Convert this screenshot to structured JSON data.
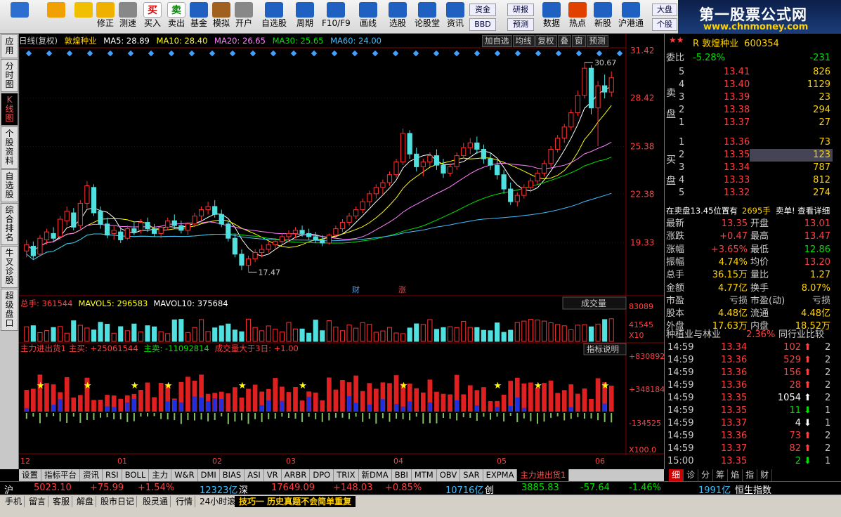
{
  "toolbar": {
    "items": [
      {
        "label": "",
        "icon": "windows-grid-icon"
      },
      {
        "label": "",
        "icon": "back-arrow-icon"
      },
      {
        "label": "",
        "icon": "updown-arrow-icon"
      },
      {
        "label": "修正",
        "icon": "smiley-icon"
      },
      {
        "label": "测速",
        "icon": "clock-icon"
      },
      {
        "label": "买入",
        "icon": "buy-icon",
        "glyph": "买"
      },
      {
        "label": "卖出",
        "icon": "sell-icon",
        "glyph": "卖"
      },
      {
        "label": "基金",
        "icon": "fund-icon"
      },
      {
        "label": "模拟",
        "icon": "hammer-icon"
      },
      {
        "label": "开户",
        "icon": "lock-icon"
      },
      {
        "label": "自选股",
        "icon": "star-folder-icon"
      },
      {
        "label": "周期",
        "icon": "clock-cycle-icon"
      },
      {
        "label": "F10/F9",
        "icon": "f10-icon"
      },
      {
        "label": "画线",
        "icon": "pen-icon"
      },
      {
        "label": "选股",
        "icon": "select-stock-icon"
      },
      {
        "label": "论股堂",
        "icon": "discuss-icon"
      },
      {
        "label": "资讯",
        "icon": "news-icon"
      },
      {
        "label": "数据",
        "icon": "pe-icon"
      },
      {
        "label": "热点",
        "icon": "hot-icon"
      },
      {
        "label": "新股",
        "icon": "new-stock-icon"
      },
      {
        "label": "沪港通",
        "icon": "hk-icon"
      }
    ],
    "small": {
      "zijin": "资金",
      "bbd": "BBD",
      "yanbao": "研报",
      "yuce": "预测",
      "dapan": "大盘",
      "gegu": "个股"
    }
  },
  "brand": {
    "title": "第一股票公式网",
    "url": "www.chnmoney.com"
  },
  "left_tabs": [
    "应用",
    "分时图",
    "K线图",
    "个股资料",
    "自选股",
    "综合排名",
    "牛叉诊股",
    "超级盘口"
  ],
  "chart_header": {
    "period": "日线(复权)",
    "stock": "敦煌种业",
    "ma5": "MA5: 28.89",
    "ma10": "MA10: 28.40",
    "ma20": "MA20: 26.65",
    "ma30": "MA30: 25.65",
    "ma60": "MA60: 24.00",
    "buttons": [
      "加自选",
      "均线",
      "复权",
      "叠",
      "窗",
      "预测"
    ]
  },
  "price_axis": [
    "31.42",
    "28.42",
    "25.38",
    "22.38",
    "19.33"
  ],
  "chart_data": [
    {
      "type": "candlestick",
      "months": [
        "12",
        "01",
        "02",
        "03",
        "04",
        "05",
        "06"
      ],
      "high_label": "30.67",
      "low_label": "17.47",
      "markers": [
        "财",
        "涨"
      ],
      "ohlc": [
        [
          18.8,
          19.5,
          18.4,
          19.2
        ],
        [
          19.1,
          19.4,
          18.3,
          18.5
        ],
        [
          18.6,
          19.8,
          18.5,
          19.6
        ],
        [
          19.5,
          20.2,
          19.2,
          20.0
        ],
        [
          19.9,
          20.3,
          19.4,
          19.6
        ],
        [
          19.7,
          21.0,
          19.5,
          20.8
        ],
        [
          20.7,
          21.6,
          20.4,
          21.3
        ],
        [
          21.2,
          21.5,
          20.1,
          20.3
        ],
        [
          20.4,
          22.0,
          20.2,
          21.8
        ],
        [
          21.8,
          23.2,
          21.5,
          22.9
        ],
        [
          22.8,
          23.0,
          21.0,
          21.2
        ],
        [
          21.3,
          21.6,
          20.2,
          20.5
        ],
        [
          20.5,
          20.9,
          19.6,
          19.8
        ],
        [
          19.9,
          20.4,
          19.5,
          20.1
        ],
        [
          20.0,
          20.3,
          19.3,
          19.5
        ],
        [
          19.6,
          20.4,
          19.5,
          20.2
        ],
        [
          20.2,
          20.6,
          19.8,
          20.0
        ],
        [
          20.1,
          20.8,
          19.9,
          20.6
        ],
        [
          20.6,
          20.9,
          20.0,
          20.2
        ],
        [
          20.2,
          20.5,
          19.7,
          19.9
        ],
        [
          19.9,
          20.4,
          19.6,
          20.3
        ],
        [
          20.3,
          20.9,
          20.1,
          20.7
        ],
        [
          20.7,
          21.1,
          20.2,
          20.4
        ],
        [
          20.4,
          20.7,
          19.9,
          20.1
        ],
        [
          20.1,
          20.6,
          19.8,
          20.5
        ],
        [
          20.5,
          21.2,
          20.3,
          21.0
        ],
        [
          21.0,
          21.6,
          20.7,
          21.4
        ],
        [
          21.4,
          21.9,
          21.1,
          21.6
        ],
        [
          21.6,
          22.0,
          20.9,
          21.1
        ],
        [
          21.1,
          21.4,
          20.3,
          20.5
        ],
        [
          20.5,
          20.7,
          19.4,
          19.6
        ],
        [
          19.6,
          19.9,
          18.4,
          18.6
        ],
        [
          18.6,
          18.9,
          17.6,
          17.9
        ],
        [
          17.9,
          18.5,
          17.47,
          18.3
        ],
        [
          18.3,
          18.9,
          18.1,
          18.7
        ],
        [
          18.7,
          19.2,
          18.4,
          18.9
        ],
        [
          18.9,
          19.4,
          18.7,
          19.2
        ],
        [
          19.2,
          19.6,
          18.9,
          19.4
        ],
        [
          19.4,
          19.9,
          19.2,
          19.7
        ],
        [
          19.7,
          20.1,
          19.4,
          19.9
        ],
        [
          19.9,
          20.3,
          19.6,
          20.1
        ],
        [
          20.1,
          20.4,
          19.7,
          19.9
        ],
        [
          19.9,
          20.2,
          19.5,
          19.7
        ],
        [
          19.7,
          20.0,
          19.3,
          19.5
        ],
        [
          19.5,
          19.8,
          19.1,
          19.3
        ],
        [
          19.3,
          19.9,
          19.2,
          19.8
        ],
        [
          19.8,
          20.4,
          19.6,
          20.2
        ],
        [
          20.2,
          20.8,
          20.0,
          20.6
        ],
        [
          20.6,
          21.2,
          20.4,
          21.0
        ],
        [
          21.0,
          21.6,
          20.8,
          21.4
        ],
        [
          21.4,
          22.1,
          21.2,
          21.9
        ],
        [
          21.9,
          22.6,
          21.6,
          22.4
        ],
        [
          22.4,
          23.0,
          22.1,
          22.8
        ],
        [
          22.8,
          23.3,
          22.3,
          23.1
        ],
        [
          23.1,
          23.8,
          22.9,
          23.6
        ],
        [
          23.6,
          24.6,
          23.4,
          24.4
        ],
        [
          24.4,
          26.5,
          24.2,
          26.2
        ],
        [
          26.2,
          26.4,
          24.6,
          24.9
        ],
        [
          24.9,
          25.3,
          23.8,
          24.1
        ],
        [
          24.1,
          24.6,
          23.5,
          24.4
        ],
        [
          24.4,
          25.0,
          24.1,
          24.8
        ],
        [
          24.8,
          25.2,
          23.9,
          24.2
        ],
        [
          24.2,
          24.6,
          23.4,
          23.7
        ],
        [
          23.7,
          24.3,
          23.5,
          24.1
        ],
        [
          24.1,
          25.0,
          23.9,
          24.8
        ],
        [
          24.8,
          25.6,
          24.6,
          25.3
        ],
        [
          25.3,
          25.9,
          24.9,
          25.6
        ],
        [
          25.6,
          26.0,
          24.9,
          25.2
        ],
        [
          25.2,
          25.5,
          24.3,
          24.6
        ],
        [
          24.6,
          25.0,
          23.9,
          24.2
        ],
        [
          24.2,
          24.5,
          23.3,
          23.6
        ],
        [
          23.6,
          23.9,
          22.4,
          22.7
        ],
        [
          22.7,
          23.1,
          21.7,
          21.9
        ],
        [
          21.9,
          22.5,
          21.6,
          22.3
        ],
        [
          22.3,
          23.0,
          22.1,
          22.8
        ],
        [
          22.8,
          23.4,
          22.5,
          23.2
        ],
        [
          23.2,
          23.9,
          23.0,
          23.7
        ],
        [
          23.7,
          24.5,
          23.5,
          24.3
        ],
        [
          24.3,
          25.4,
          24.1,
          25.2
        ],
        [
          25.2,
          26.1,
          25.0,
          25.9
        ],
        [
          25.9,
          26.8,
          25.6,
          26.6
        ],
        [
          26.6,
          27.7,
          26.4,
          27.5
        ],
        [
          27.5,
          28.9,
          27.3,
          28.6
        ],
        [
          28.6,
          30.67,
          28.4,
          30.3
        ],
        [
          30.3,
          30.5,
          27.4,
          27.8
        ],
        [
          27.8,
          29.5,
          25.4,
          29.2
        ],
        [
          29.2,
          29.9,
          28.4,
          28.8
        ],
        [
          28.8,
          30.1,
          28.5,
          29.7
        ]
      ],
      "ma": {
        "MA5": {
          "last": 28.89,
          "color": "#ffffff"
        },
        "MA10": {
          "last": 28.4,
          "color": "#ffff00"
        },
        "MA20": {
          "last": 26.65,
          "color": "#ff80ff"
        },
        "MA30": {
          "last": 25.65,
          "color": "#00e000"
        },
        "MA60": {
          "last": 24.0,
          "color": "#40c0ff"
        }
      }
    },
    {
      "type": "bar",
      "name": "成交量",
      "title": "总手: 361544",
      "mavol5": "MAVOL5: 296583",
      "mavol10": "MAVOL10: 375684",
      "axis": [
        "83089",
        "41545",
        "X10"
      ]
    },
    {
      "type": "bar",
      "name": "主力进出货1",
      "title": "主力进出货1",
      "zhumai": "主买: +25061544",
      "zhumai2": "主卖: -11092814",
      "cond": "成交量大于3日: +1.00",
      "axis": [
        "+830892",
        "+348184",
        "-134525",
        "X100.0"
      ]
    }
  ],
  "volume_selector": "成交量",
  "indicator_btn": "指标说明",
  "bottom_tabs": [
    "设置",
    "指标平台",
    "资讯",
    "RSI",
    "BOLL",
    "主力",
    "W&R",
    "DMI",
    "BIAS",
    "ASI",
    "VR",
    "ARBR",
    "DPO",
    "TRIX",
    "新DMA",
    "BBI",
    "MTM",
    "OBV",
    "SAR",
    "EXPMA",
    "主力进出货1"
  ],
  "quote": {
    "title": "R 敦煌种业",
    "code": "600354",
    "weibi_label": "委比",
    "weibi": "-5.28%",
    "weicha": "-231",
    "sell": [
      [
        "5",
        "13.41",
        "826"
      ],
      [
        "4",
        "13.40",
        "1129"
      ],
      [
        "3",
        "13.39",
        "23"
      ],
      [
        "2",
        "13.38",
        "294"
      ],
      [
        "1",
        "13.37",
        "27"
      ]
    ],
    "buy": [
      [
        "1",
        "13.36",
        "73"
      ],
      [
        "2",
        "13.35",
        "123"
      ],
      [
        "3",
        "13.34",
        "787"
      ],
      [
        "4",
        "13.33",
        "812"
      ],
      [
        "5",
        "13.32",
        "274"
      ]
    ],
    "sell_label": "卖盘",
    "buy_label": "买盘",
    "notice": "在卖盘13.45位置有",
    "notice_val": "2695手",
    "notice_link": "卖单! 查看详细",
    "stats": [
      [
        "最新",
        "13.35",
        "开盘",
        "13.01"
      ],
      [
        "涨跌",
        "+0.47",
        "最高",
        "13.47"
      ],
      [
        "涨幅",
        "+3.65%",
        "最低",
        "12.86"
      ],
      [
        "振幅",
        "4.74%",
        "均价",
        "13.20"
      ],
      [
        "总手",
        "36.15万",
        "量比",
        "1.27"
      ],
      [
        "金额",
        "4.77亿",
        "换手",
        "8.07%"
      ],
      [
        "市盈",
        "亏损",
        "市盈(动)",
        "亏损"
      ],
      [
        "股本",
        "4.48亿",
        "流通",
        "4.48亿"
      ],
      [
        "外盘",
        "17.63万",
        "内盘",
        "18.52万"
      ]
    ],
    "industry": "种植业与林业",
    "industry_pct": "2.36%",
    "industry_btn": "同行业比较",
    "ticks": [
      [
        "14:59",
        "13.34",
        "102",
        "2"
      ],
      [
        "14:59",
        "13.36",
        "529",
        "2"
      ],
      [
        "14:59",
        "13.36",
        "156",
        "2"
      ],
      [
        "14:59",
        "13.36",
        "28",
        "2"
      ],
      [
        "14:59",
        "13.35",
        "1054",
        "2"
      ],
      [
        "14:59",
        "13.35",
        "11",
        "1"
      ],
      [
        "14:59",
        "13.37",
        "4",
        "1"
      ],
      [
        "14:59",
        "13.36",
        "73",
        "2"
      ],
      [
        "14:59",
        "13.37",
        "82",
        "2"
      ],
      [
        "15:00",
        "13.35",
        "2",
        "1"
      ]
    ]
  },
  "right_tabs": [
    "细",
    "诊",
    "分",
    "筹",
    "焰",
    "指",
    "财"
  ],
  "status": {
    "sh_label": "沪",
    "sh": "5023.10",
    "sh_chg": "+75.99",
    "sh_pct": "+1.54%",
    "sh_amt": "12323亿",
    "sz_label": "深",
    "sz": "17649.09",
    "sz_chg": "+148.03",
    "sz_pct": "+0.85%",
    "sz_amt": "10716亿",
    "cy_label": "创",
    "cy": "3885.83",
    "cy_chg": "-57.64",
    "cy_pct": "-1.46%",
    "cy_amt": "1991亿",
    "hs": "恒生指数"
  },
  "status2": {
    "items": [
      "手机",
      "留言",
      "客服",
      "解盘",
      "股市日记",
      "股灵通",
      "行情",
      "24小时滚动"
    ],
    "tip": "技巧一 历史真题不会简单重复"
  }
}
